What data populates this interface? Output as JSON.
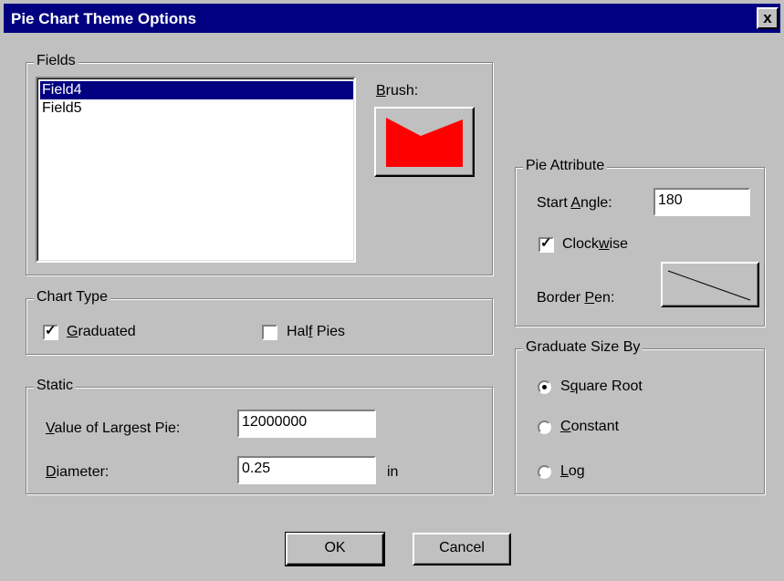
{
  "title": "Pie Chart Theme Options",
  "close_glyph": "x",
  "fields": {
    "legend": "Fields",
    "items": [
      "Field4",
      "Field5"
    ],
    "selected": "Field4",
    "brush_label_pre": "",
    "brush_label_u": "B",
    "brush_label_post": "rush:",
    "brush_color": "#ff0000"
  },
  "chart_type": {
    "legend": "Chart Type",
    "graduated": {
      "u": "G",
      "rest": "raduated",
      "checked": true
    },
    "half_pies": {
      "pre": "Hal",
      "u": "f",
      "rest": " Pies",
      "checked": false
    }
  },
  "static": {
    "legend": "Static",
    "largest_label_u": "V",
    "largest_label_rest": "alue of Largest Pie:",
    "largest_value": "12000000",
    "diameter_label_u": "D",
    "diameter_label_rest": "iameter:",
    "diameter_value": "0.25",
    "unit": "in"
  },
  "pie_attribute": {
    "legend": "Pie Attribute",
    "start_angle_pre": "Start ",
    "start_angle_u": "A",
    "start_angle_rest": "ngle:",
    "start_angle_value": "180",
    "clockwise_pre": "Clock",
    "clockwise_u": "w",
    "clockwise_rest": "ise",
    "clockwise_checked": true,
    "border_pen_pre": "Border ",
    "border_pen_u": "P",
    "border_pen_rest": "en:"
  },
  "graduate": {
    "legend": "Graduate Size By",
    "options": [
      {
        "pre": "S",
        "u": "q",
        "rest": "uare Root",
        "selected": true
      },
      {
        "pre": "",
        "u": "C",
        "rest": "onstant",
        "selected": false
      },
      {
        "pre": "",
        "u": "L",
        "rest": "og",
        "selected": false
      }
    ]
  },
  "buttons": {
    "ok": "OK",
    "cancel": "Cancel"
  }
}
